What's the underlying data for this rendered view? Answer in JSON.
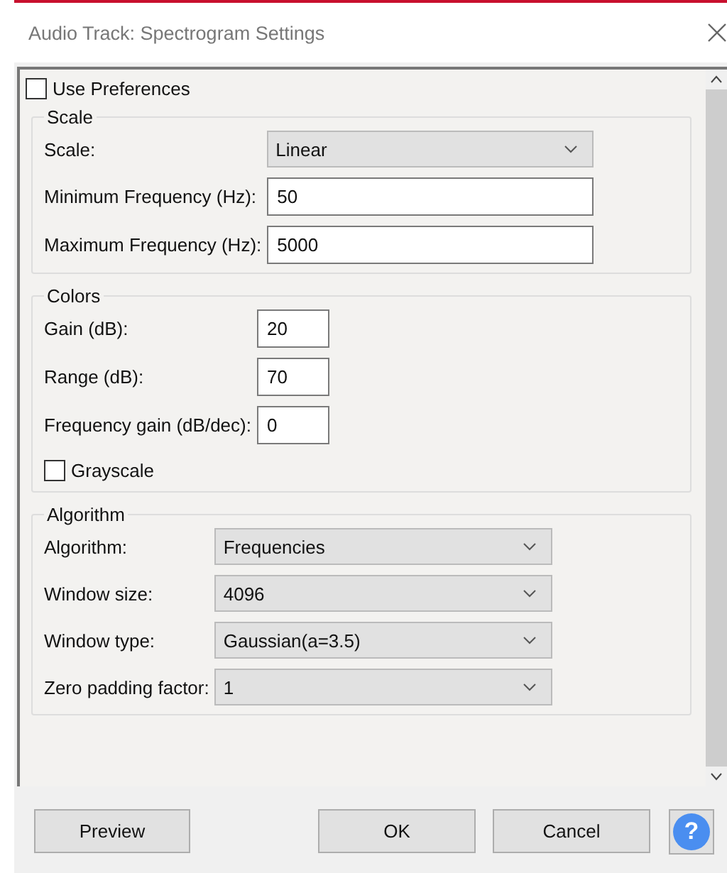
{
  "window": {
    "title": "Audio Track: Spectrogram Settings"
  },
  "use_preferences": {
    "label": "Use Preferences",
    "checked": false
  },
  "groups": [
    {
      "title": "Scale",
      "fields": [
        {
          "kind": "select",
          "label": "Scale:",
          "value": "Linear"
        },
        {
          "kind": "text",
          "label": "Minimum Frequency (Hz):",
          "value": "50"
        },
        {
          "kind": "text",
          "label": "Maximum Frequency (Hz):",
          "value": "5000"
        }
      ]
    },
    {
      "title": "Colors",
      "fields": [
        {
          "kind": "number",
          "label": "Gain (dB):",
          "value": "20"
        },
        {
          "kind": "number",
          "label": "Range (dB):",
          "value": "70"
        },
        {
          "kind": "number",
          "label": "Frequency gain (dB/dec):",
          "value": "0"
        },
        {
          "kind": "checkbox",
          "label": "Grayscale",
          "checked": false
        }
      ]
    },
    {
      "title": "Algorithm",
      "fields": [
        {
          "kind": "select",
          "label": "Algorithm:",
          "value": "Frequencies"
        },
        {
          "kind": "select",
          "label": "Window size:",
          "value": "4096"
        },
        {
          "kind": "select",
          "label": "Window type:",
          "value": "Gaussian(a=3.5)"
        },
        {
          "kind": "select",
          "label": "Zero padding factor:",
          "value": "1"
        }
      ]
    }
  ],
  "buttons": [
    {
      "label": "Preview"
    },
    {
      "label": "OK"
    },
    {
      "label": "Cancel"
    }
  ],
  "help": "?"
}
